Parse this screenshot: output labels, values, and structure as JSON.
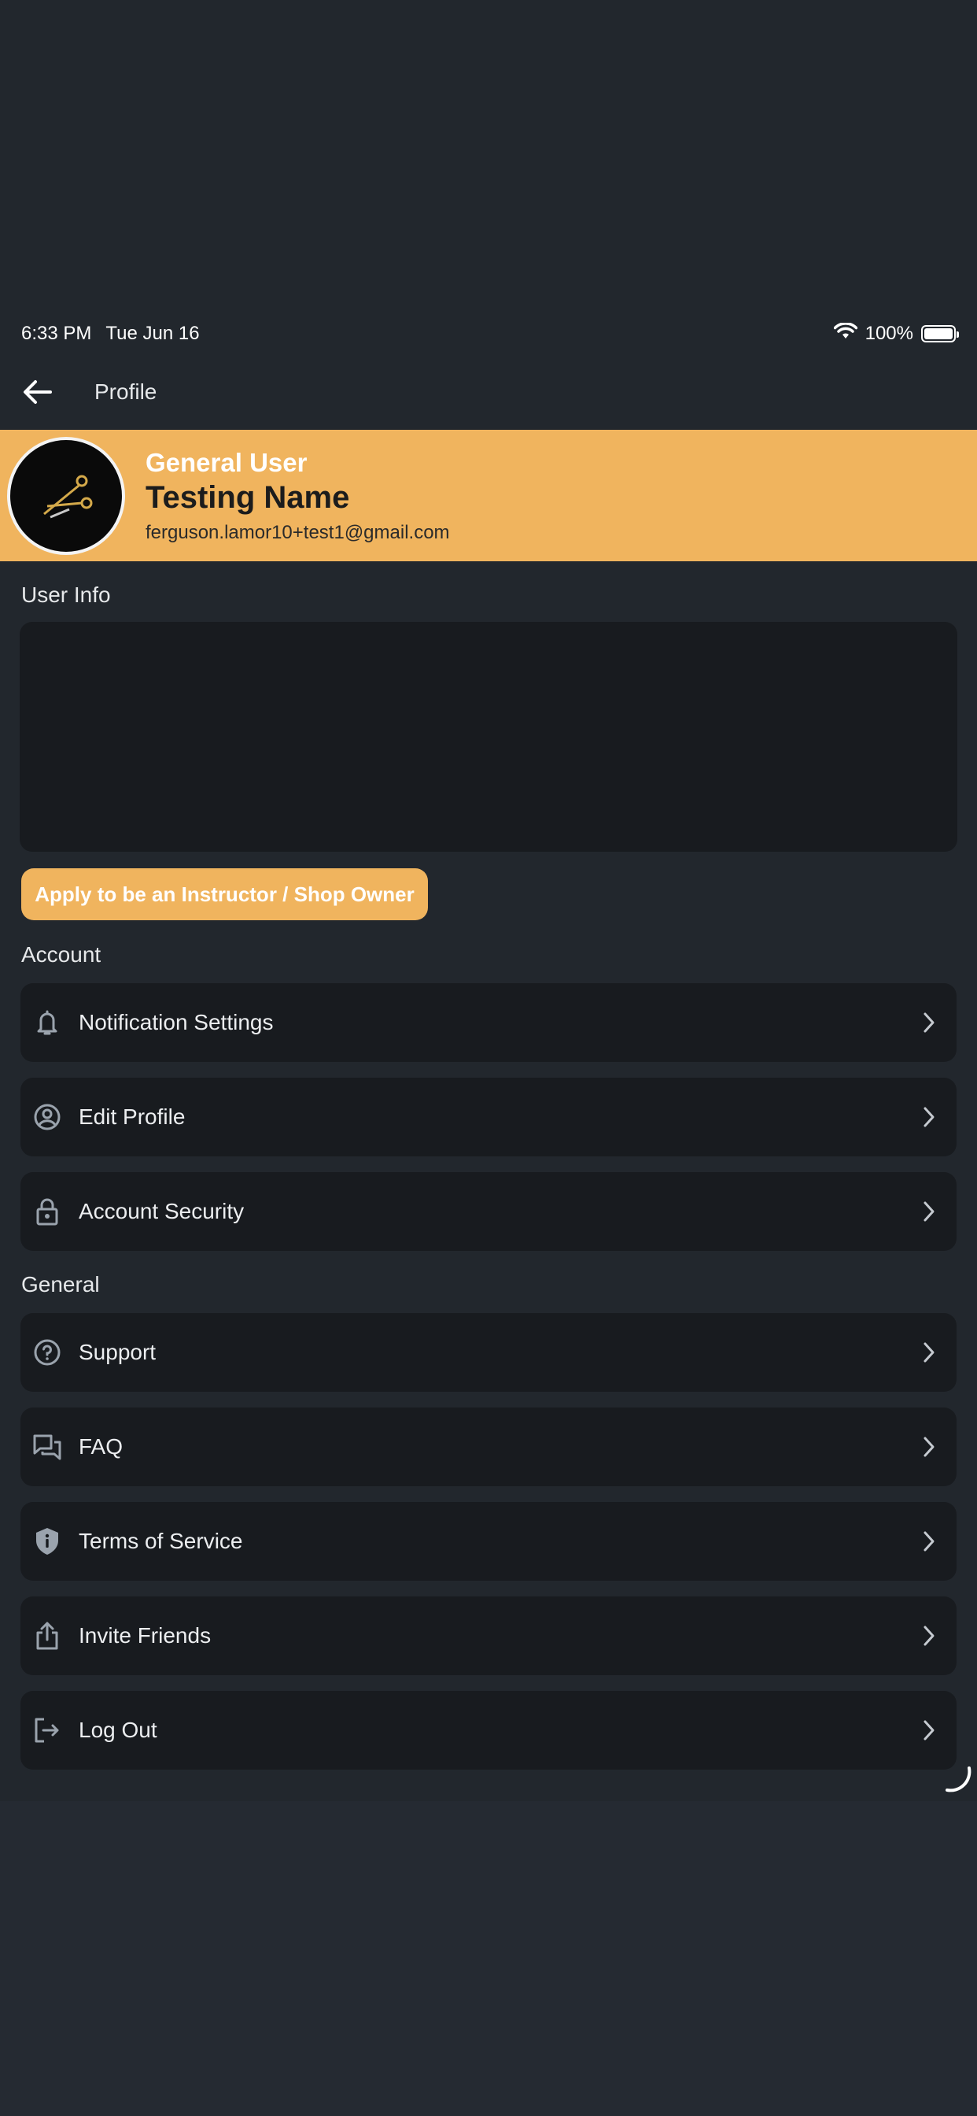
{
  "status_bar": {
    "time": "6:33 PM",
    "date": "Tue Jun 16",
    "battery": "100%",
    "battery_level": 1.0
  },
  "nav": {
    "title": "Profile"
  },
  "profile": {
    "role": "General User",
    "name": "Testing Name",
    "email": "ferguson.lamor10+test1@gmail.com"
  },
  "user_info": {
    "label": "User Info"
  },
  "apply_button": {
    "label": "Apply to be an Instructor / Shop Owner"
  },
  "account": {
    "label": "Account",
    "items": [
      {
        "label": "Notification Settings",
        "icon": "bell-icon"
      },
      {
        "label": "Edit Profile",
        "icon": "user-circle-icon"
      },
      {
        "label": "Account Security",
        "icon": "lock-icon"
      }
    ]
  },
  "general": {
    "label": "General",
    "items": [
      {
        "label": "Support",
        "icon": "help-circle-icon"
      },
      {
        "label": "FAQ",
        "icon": "chat-bubbles-icon"
      },
      {
        "label": "Terms of Service",
        "icon": "shield-info-icon"
      },
      {
        "label": "Invite Friends",
        "icon": "share-icon"
      },
      {
        "label": "Log Out",
        "icon": "logout-icon"
      }
    ]
  },
  "colors": {
    "accent": "#f0b45e",
    "background": "#22272d",
    "card": "#181b1f",
    "icon": "#9aa3ad"
  }
}
